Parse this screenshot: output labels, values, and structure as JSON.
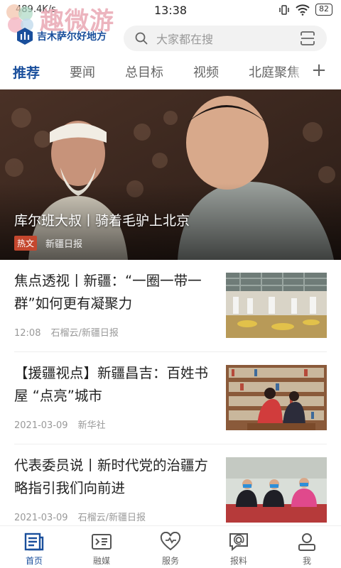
{
  "status_bar": {
    "left_text": "489.4K/s",
    "time": "13:38",
    "battery": "82"
  },
  "watermark": {
    "text": "趣微游"
  },
  "header": {
    "logo_text": "吉木萨尔好地方",
    "search_placeholder": "大家都在搜"
  },
  "tabs": [
    {
      "label": "推荐",
      "active": true
    },
    {
      "label": "要闻"
    },
    {
      "label": "总目标"
    },
    {
      "label": "视频"
    },
    {
      "label": "北庭聚焦"
    }
  ],
  "tab_add_label": "+",
  "hero": {
    "title": "库尔班大叔丨骑着毛驴上北京",
    "tag": "热文",
    "source": "新疆日报"
  },
  "news": [
    {
      "title": "焦点透视丨新疆：“一圈一带一群”如何更有凝聚力",
      "time": "12:08",
      "source": "石榴云/新疆日报"
    },
    {
      "title": "【援疆视点】新疆昌吉：百姓书屋 “点亮”城市",
      "time": "2021-03-09",
      "source": "新华社"
    },
    {
      "title": "代表委员说丨新时代党的治疆方略指引我们向前进",
      "time": "2021-03-09",
      "source": "石榴云/新疆日报"
    }
  ],
  "bottom_nav": [
    {
      "label": "首页",
      "icon": "news-icon",
      "active": true
    },
    {
      "label": "融媒",
      "icon": "media-icon"
    },
    {
      "label": "服务",
      "icon": "heart-icon"
    },
    {
      "label": "报料",
      "icon": "report-icon"
    },
    {
      "label": "我",
      "icon": "user-icon"
    }
  ],
  "colors": {
    "accent": "#1a4f9c",
    "tag": "#c4472e"
  }
}
